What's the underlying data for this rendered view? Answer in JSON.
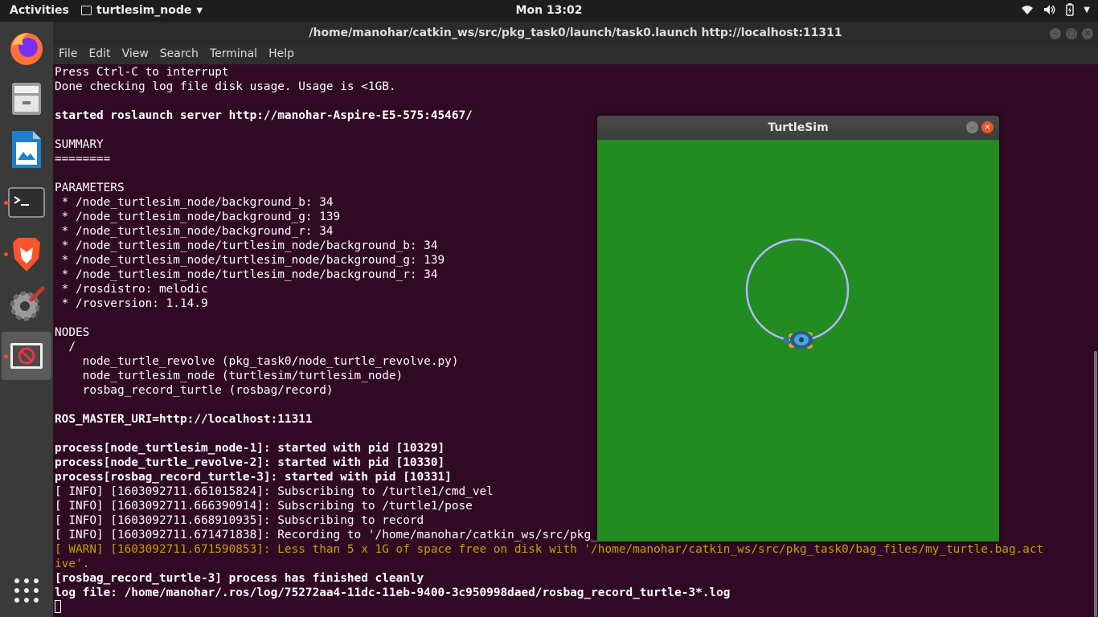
{
  "topbar": {
    "activities": "Activities",
    "app_name": "turtlesim_node",
    "clock": "Mon 13:02",
    "icons": [
      "wifi-icon",
      "volume-icon",
      "battery-icon",
      "power-menu-icon"
    ]
  },
  "dock": {
    "items": [
      "firefox",
      "files",
      "libreoffice-writer",
      "terminal",
      "brave-browser",
      "software-settings",
      "turtlesim-app"
    ],
    "show_apps": "show-applications-icon"
  },
  "terminal": {
    "title": "/home/manohar/catkin_ws/src/pkg_task0/launch/task0.launch http://localhost:11311",
    "menu": [
      "File",
      "Edit",
      "View",
      "Search",
      "Terminal",
      "Help"
    ],
    "lines": [
      {
        "text": "Press Ctrl-C to interrupt",
        "style": "normal"
      },
      {
        "text": "Done checking log file disk usage. Usage is <1GB.",
        "style": "normal"
      },
      {
        "text": "",
        "style": "normal"
      },
      {
        "text": "started roslaunch server http://manohar-Aspire-E5-575:45467/",
        "style": "bold"
      },
      {
        "text": "",
        "style": "normal"
      },
      {
        "text": "SUMMARY",
        "style": "normal"
      },
      {
        "text": "========",
        "style": "normal"
      },
      {
        "text": "",
        "style": "normal"
      },
      {
        "text": "PARAMETERS",
        "style": "normal"
      },
      {
        "text": " * /node_turtlesim_node/background_b: 34",
        "style": "normal"
      },
      {
        "text": " * /node_turtlesim_node/background_g: 139",
        "style": "normal"
      },
      {
        "text": " * /node_turtlesim_node/background_r: 34",
        "style": "normal"
      },
      {
        "text": " * /node_turtlesim_node/turtlesim_node/background_b: 34",
        "style": "normal"
      },
      {
        "text": " * /node_turtlesim_node/turtlesim_node/background_g: 139",
        "style": "normal"
      },
      {
        "text": " * /node_turtlesim_node/turtlesim_node/background_r: 34",
        "style": "normal"
      },
      {
        "text": " * /rosdistro: melodic",
        "style": "normal"
      },
      {
        "text": " * /rosversion: 1.14.9",
        "style": "normal"
      },
      {
        "text": "",
        "style": "normal"
      },
      {
        "text": "NODES",
        "style": "normal"
      },
      {
        "text": "  /",
        "style": "normal"
      },
      {
        "text": "    node_turtle_revolve (pkg_task0/node_turtle_revolve.py)",
        "style": "normal"
      },
      {
        "text": "    node_turtlesim_node (turtlesim/turtlesim_node)",
        "style": "normal"
      },
      {
        "text": "    rosbag_record_turtle (rosbag/record)",
        "style": "normal"
      },
      {
        "text": "",
        "style": "normal"
      },
      {
        "text": "ROS_MASTER_URI=http://localhost:11311",
        "style": "bold"
      },
      {
        "text": "",
        "style": "normal"
      },
      {
        "text": "process[node_turtlesim_node-1]: started with pid [10329]",
        "style": "bold"
      },
      {
        "text": "process[node_turtle_revolve-2]: started with pid [10330]",
        "style": "bold"
      },
      {
        "text": "process[rosbag_record_turtle-3]: started with pid [10331]",
        "style": "bold"
      },
      {
        "text": "[ INFO] [1603092711.661015824]: Subscribing to /turtle1/cmd_vel",
        "style": "normal"
      },
      {
        "text": "[ INFO] [1603092711.666390914]: Subscribing to /turtle1/pose",
        "style": "normal"
      },
      {
        "text": "[ INFO] [1603092711.668910935]: Subscribing to record",
        "style": "normal"
      },
      {
        "text": "[ INFO] [1603092711.671471838]: Recording to '/home/manohar/catkin_ws/src/pkg_task0/bag_files/my_turtle.bag'.",
        "style": "normal"
      },
      {
        "text": "[ WARN] [1603092711.671590853]: Less than 5 x 1G of space free on disk with '/home/manohar/catkin_ws/src/pkg_task0/bag_files/my_turtle.bag.act",
        "style": "warn"
      },
      {
        "text": "ive'.",
        "style": "warn"
      },
      {
        "text": "[rosbag_record_turtle-3] process has finished cleanly",
        "style": "bold"
      },
      {
        "text": "log file: /home/manohar/.ros/log/75272aa4-11dc-11eb-9400-3c950998daed/rosbag_record_turtle-3*.log",
        "style": "bold"
      }
    ]
  },
  "turtlesim": {
    "title": "TurtleSim",
    "background_color": "#228b22",
    "pen_color": "#b3b8ff"
  }
}
